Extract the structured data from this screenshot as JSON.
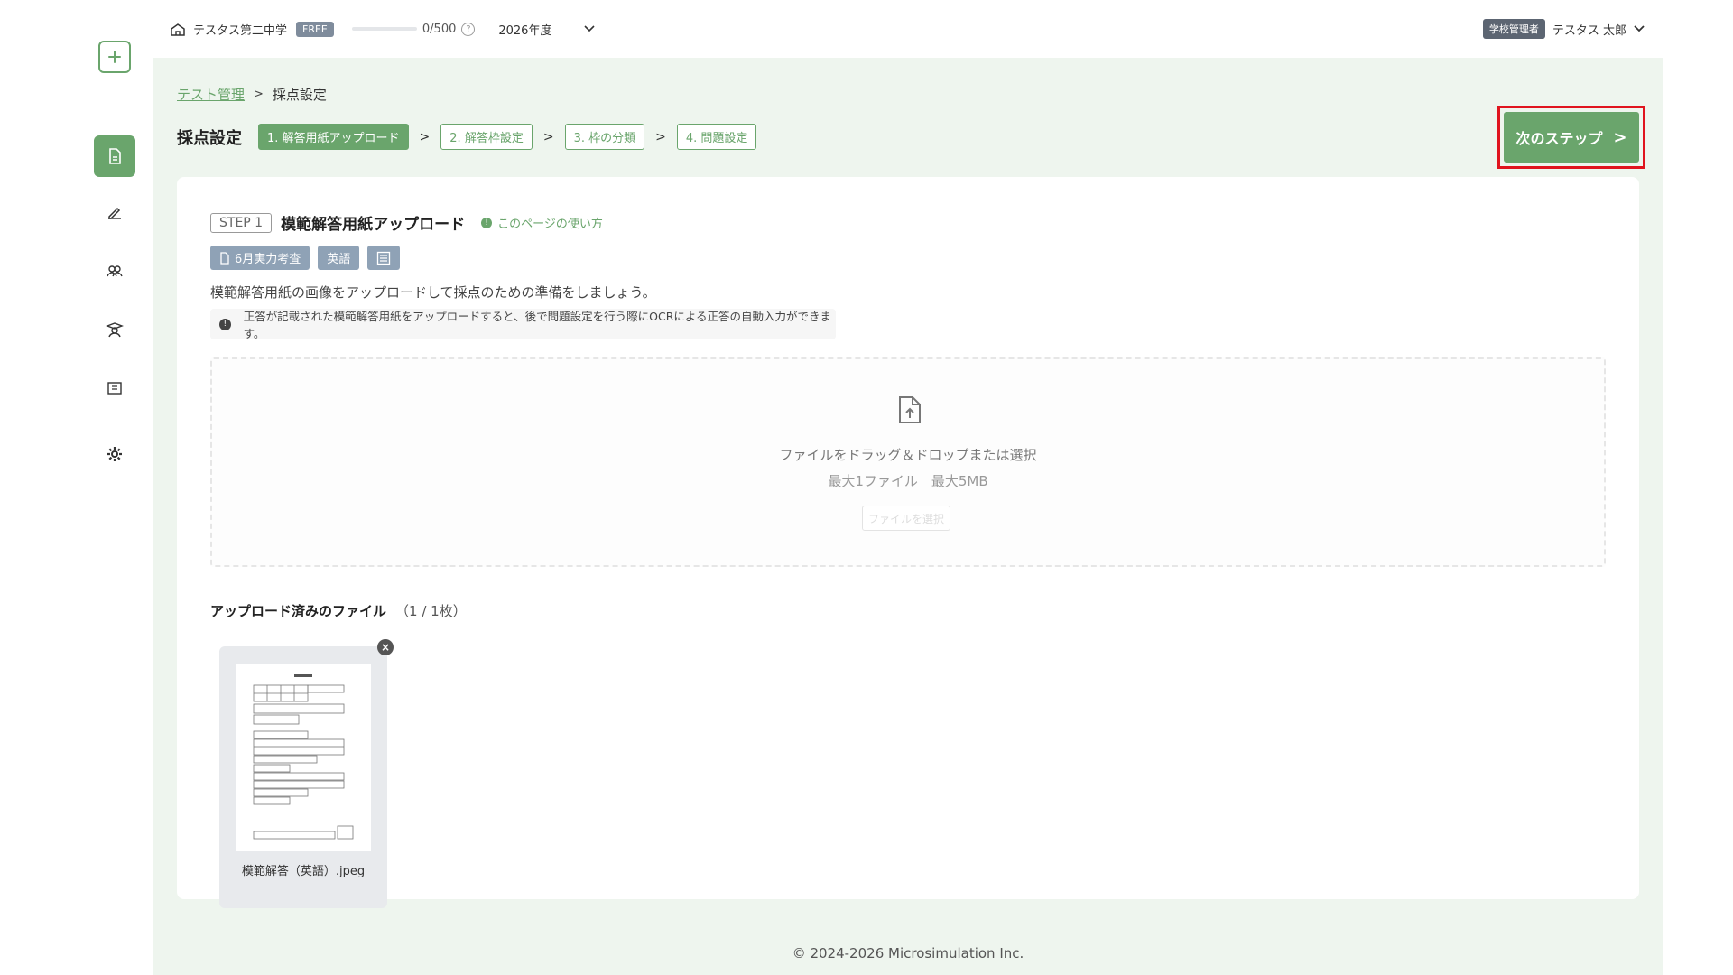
{
  "topbar": {
    "school_name": "テスタス第二中学",
    "plan_badge": "FREE",
    "quota": "0/500",
    "quota_fraction": 0,
    "help_symbol": "?",
    "year": "2026年度",
    "role_badge": "学校管理者",
    "user_name": "テスタス 太郎"
  },
  "sidebar": {
    "items": [
      {
        "icon": "plus-icon"
      },
      {
        "icon": "document-icon",
        "active": true
      },
      {
        "icon": "pen-icon"
      },
      {
        "icon": "group-icon"
      },
      {
        "icon": "student-icon"
      },
      {
        "icon": "book-icon"
      },
      {
        "icon": "gear-icon"
      }
    ]
  },
  "breadcrumb": {
    "parent": "テスト管理",
    "separator": ">",
    "current": "採点設定"
  },
  "steps": {
    "title": "採点設定",
    "arrow": ">",
    "items": [
      {
        "label": "1. 解答用紙アップロード",
        "active": true
      },
      {
        "label": "2. 解答枠設定",
        "active": false
      },
      {
        "label": "3. 枠の分類",
        "active": false
      },
      {
        "label": "4. 問題設定",
        "active": false
      }
    ]
  },
  "next_button": {
    "label": "次のステップ",
    "chevron": ">",
    "highlight_color": "#e0141e"
  },
  "card": {
    "step_pill": "STEP 1",
    "title": "模範解答用紙アップロード",
    "howto_symbol": "!",
    "howto_link": "このページの使い方",
    "chips": [
      {
        "label": "6月実力考査",
        "icon": "document-icon"
      },
      {
        "label": "英語"
      },
      {
        "label": "",
        "icon": "list-icon"
      }
    ],
    "description": "模範解答用紙の画像をアップロードして採点のための準備をしましょう。",
    "notice_symbol": "!",
    "notice": "正答が記載された模範解答用紙をアップロードすると、後で問題設定を行う際にOCRによる正答の自動入力ができます。"
  },
  "dropzone": {
    "main_text": "ファイルをドラッグ＆ドロップまたは選択",
    "sub_text": "最大1ファイル　最大5MB",
    "button_label": "ファイルを選択"
  },
  "uploaded": {
    "title": "アップロード済みのファイル",
    "count": "（1 / 1枚）",
    "files": [
      {
        "name": "模範解答（英語）.jpeg",
        "remove_symbol": "×"
      }
    ]
  },
  "footer": {
    "copyright": "© 2024-2026 Microsimulation Inc."
  },
  "colors": {
    "accent": "#6aa56c",
    "background": "#eef5ee",
    "chip": "#8fa2b6"
  }
}
